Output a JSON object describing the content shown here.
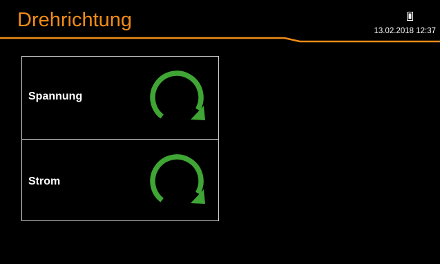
{
  "header": {
    "title": "Drehrichtung",
    "datetime": "13.02.2018  12:37",
    "storage_icon": "sd-card-icon",
    "accent_color": "#f28c17"
  },
  "rows": [
    {
      "label": "Spannung",
      "icon": "clockwise-rotation-icon",
      "icon_color": "#3fa535"
    },
    {
      "label": "Strom",
      "icon": "clockwise-rotation-icon",
      "icon_color": "#3fa535"
    }
  ]
}
